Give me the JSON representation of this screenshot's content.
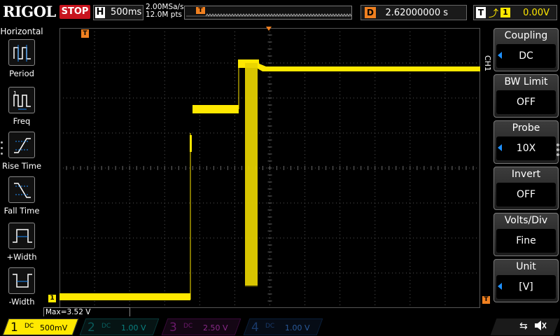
{
  "top": {
    "brand": "RIGOL",
    "run_state": "STOP",
    "timebase_label": "H",
    "timebase_value": "500ms",
    "sample_rate": "2.00MSa/s",
    "memory_depth": "12.0M pts",
    "delay_label": "D",
    "delay_value": "2.62000000 s",
    "trigger_label": "T",
    "trigger_edge": "⤴",
    "trigger_source": "1",
    "trigger_level": "0.00V"
  },
  "left_panel": {
    "title": "Horizontal",
    "items": [
      {
        "label": "Period",
        "icon": "period-icon"
      },
      {
        "label": "Freq",
        "icon": "freq-icon"
      },
      {
        "label": "Rise Time",
        "icon": "rise-time-icon"
      },
      {
        "label": "Fall Time",
        "icon": "fall-time-icon"
      },
      {
        "label": "+Width",
        "icon": "positive-width-icon"
      },
      {
        "label": "-Width",
        "icon": "negative-width-icon"
      }
    ]
  },
  "screen": {
    "trigger_marker": "T",
    "ch1_marker": "1",
    "trigger_level_marker": "T",
    "measurement": "Max=3.52 V",
    "trace_color": "#ffe800"
  },
  "right_menu": {
    "channel_tab": "CH1",
    "items": [
      {
        "title": "Coupling",
        "value": "DC",
        "has_arrow": true
      },
      {
        "title": "BW Limit",
        "value": "OFF",
        "has_arrow": false
      },
      {
        "title": "Probe",
        "value": "10X",
        "has_arrow": true
      },
      {
        "title": "Invert",
        "value": "OFF",
        "has_arrow": false
      },
      {
        "title": "Volts/Div",
        "value": "Fine",
        "has_arrow": false
      },
      {
        "title": "Unit",
        "value": "[V]",
        "has_arrow": true
      }
    ]
  },
  "bottom": {
    "channels": [
      {
        "num": "1",
        "coupling": "DC",
        "scale": "500mV",
        "color": "#ffe800",
        "active": true
      },
      {
        "num": "2",
        "coupling": "DC",
        "scale": "1.00 V",
        "color": "#00c0c0",
        "active": false
      },
      {
        "num": "3",
        "coupling": "DC",
        "scale": "2.50 V",
        "color": "#e040e0",
        "active": false
      },
      {
        "num": "4",
        "coupling": "DC",
        "scale": "1.00 V",
        "color": "#3a8ae0",
        "active": false
      }
    ],
    "usb_icon": "usb-icon",
    "speaker_icon": "speaker-muted-icon"
  }
}
